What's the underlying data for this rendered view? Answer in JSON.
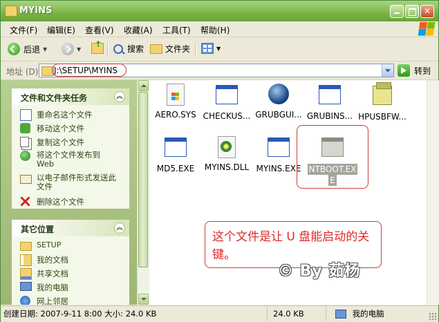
{
  "window": {
    "title": "MYINS",
    "controls": {
      "minimize": "_",
      "close": "✕"
    }
  },
  "menu": [
    "文件(F)",
    "编辑(E)",
    "查看(V)",
    "收藏(A)",
    "工具(T)",
    "帮助(H)"
  ],
  "toolbar": {
    "back": "后退",
    "search": "搜索",
    "folders": "文件夹"
  },
  "address": {
    "label": "地址 (D)",
    "value": "J:\\SETUP\\MYINS",
    "go": "转到"
  },
  "tasks_panel": {
    "title": "文件和文件夹任务",
    "items": [
      {
        "label": "重命名这个文件",
        "icon": "rename-icon"
      },
      {
        "label": "移动这个文件",
        "icon": "move-icon"
      },
      {
        "label": "复制这个文件",
        "icon": "copy-icon"
      },
      {
        "label": "将这个文件发布到 Web",
        "icon": "publish-web-icon"
      },
      {
        "label": "以电子邮件形式发送此文件",
        "icon": "email-icon"
      },
      {
        "label": "删除这个文件",
        "icon": "delete-icon"
      }
    ]
  },
  "places_panel": {
    "title": "其它位置",
    "items": [
      {
        "label": "SETUP",
        "icon": "folder-icon"
      },
      {
        "label": "我的文档",
        "icon": "my-documents-icon"
      },
      {
        "label": "共享文档",
        "icon": "shared-documents-icon"
      },
      {
        "label": "我的电脑",
        "icon": "my-computer-icon"
      },
      {
        "label": "网上邻居",
        "icon": "network-icon"
      }
    ]
  },
  "files": [
    {
      "name": "AERO.SYS",
      "icon": "system-file-icon"
    },
    {
      "name": "CHECKUS...",
      "icon": "exe-window-icon"
    },
    {
      "name": "GRUBGUI...",
      "icon": "grub-icon"
    },
    {
      "name": "GRUBINS...",
      "icon": "exe-window-icon"
    },
    {
      "name": "HPUSBFW...",
      "icon": "hp-usb-icon"
    },
    {
      "name": "MD5.EXE",
      "icon": "exe-window-icon"
    },
    {
      "name": "MYINS.DLL",
      "icon": "dll-icon"
    },
    {
      "name": "MYINS.EXE",
      "icon": "exe-window-icon"
    },
    {
      "name_line1": "NTBOOT.EX",
      "name_line2": "E",
      "icon": "exe-window-icon",
      "selected": true
    }
  ],
  "annotation": {
    "note": "这个文件是让 U 盘能启动的关键。",
    "watermark": "© By 茹杨"
  },
  "status": {
    "details": "创建日期: 2007-9-11 8:00 大小: 24.0 KB",
    "size": "24.0 KB",
    "location": "我的电脑"
  },
  "colors": {
    "titlebar": "#79B347",
    "annotation_red": "#D23A3A",
    "selection": "#A4A59C"
  }
}
